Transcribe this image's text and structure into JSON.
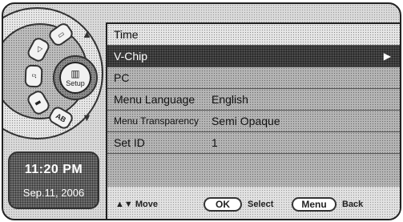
{
  "sidebar": {
    "center_label": "Setup",
    "center_glyph": "▥",
    "seg_glyphs": [
      "▭",
      "◁",
      "♫",
      "▮",
      "AB"
    ],
    "up_arrow": "▲",
    "down_arrow": "▼"
  },
  "clock": {
    "time": "11:20 PM",
    "date": "Sep.11, 2006"
  },
  "menu": {
    "items": [
      {
        "name": "Time",
        "value": ""
      },
      {
        "name": "V-Chip",
        "value": "",
        "arrow": "▶"
      },
      {
        "name": "PC",
        "value": ""
      },
      {
        "name": "Menu Language",
        "value": "English"
      },
      {
        "name": "Menu Transparency",
        "value": "Semi Opaque"
      },
      {
        "name": "Set ID",
        "value": "1"
      }
    ]
  },
  "footer": {
    "move": "▲▼ Move",
    "ok": "OK",
    "select": "Select",
    "menu": "Menu",
    "back": "Back"
  }
}
